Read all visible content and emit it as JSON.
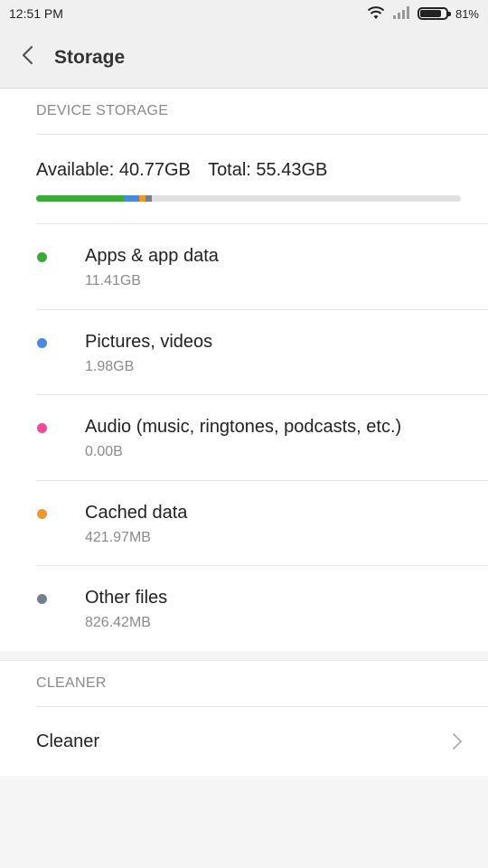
{
  "status_bar": {
    "time": "12:51 PM",
    "battery_text": "81%",
    "battery_level": 0.81
  },
  "header": {
    "title": "Storage"
  },
  "device_storage": {
    "section_label": "DEVICE STORAGE",
    "available": "Available: 40.77GB",
    "total": "Total: 55.43GB",
    "usage_bar": [
      {
        "color": "#3aac35",
        "fraction": 0.206
      },
      {
        "color": "#4a88e0",
        "fraction": 0.036
      },
      {
        "color": "#f0962c",
        "fraction": 0.016
      },
      {
        "color": "#747f8f",
        "fraction": 0.015
      }
    ],
    "categories": [
      {
        "label": "Apps & app data",
        "size": "11.41GB",
        "color": "#3aac35"
      },
      {
        "label": "Pictures, videos",
        "size": "1.98GB",
        "color": "#4a88e0"
      },
      {
        "label": "Audio (music, ringtones, podcasts, etc.)",
        "size": "0.00B",
        "color": "#ee4a96"
      },
      {
        "label": "Cached data",
        "size": "421.97MB",
        "color": "#f0962c"
      },
      {
        "label": "Other files",
        "size": "826.42MB",
        "color": "#747f8f"
      }
    ]
  },
  "cleaner": {
    "section_label": "CLEANER",
    "item_label": "Cleaner"
  }
}
